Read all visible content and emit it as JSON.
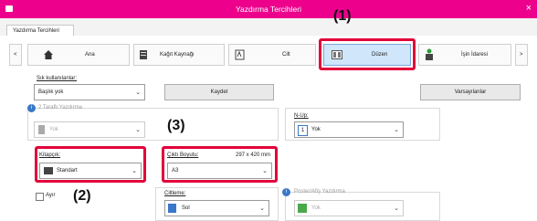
{
  "window": {
    "title": "Yazdırma Tercihleri"
  },
  "tab": {
    "label": "Yazdırma Tercihleri"
  },
  "nav": {
    "prev": "<",
    "next": ">",
    "items": [
      {
        "label": "Ana"
      },
      {
        "label": "Kağıt Kaynağı"
      },
      {
        "label": "Cilt"
      },
      {
        "label": "Düzen"
      },
      {
        "label": "İşin İdaresi"
      }
    ]
  },
  "favorites": {
    "label": "Sık kullanılanlar:",
    "value": "Başlık yok",
    "save_label": "Kaydet",
    "defaults_label": "Varsayılanlar"
  },
  "duplex": {
    "label": "2 Taraflı Yazdırma",
    "value": "Yok"
  },
  "nup": {
    "label": "N-Up:",
    "value": "Yok",
    "icon_text": "1"
  },
  "booklet": {
    "label": "Kitapçık:",
    "value": "Standart"
  },
  "output_size": {
    "label": "Çıktı Boyutu:",
    "size_text": "297 x 420 mm",
    "value": "A3"
  },
  "tab_option": {
    "label": "Ayır"
  },
  "stapling": {
    "label": "Ciltleme:",
    "value": "Sol"
  },
  "poster": {
    "label": "Poster/Afiş Yazdırma",
    "value": "Yok"
  },
  "callouts": {
    "c1": "(1)",
    "c2": "(2)",
    "c3": "(3)"
  },
  "colors": {
    "titlebar": "#ec008c",
    "highlight": "#e2003a",
    "selected_tab_bg": "#cfe6fb"
  }
}
